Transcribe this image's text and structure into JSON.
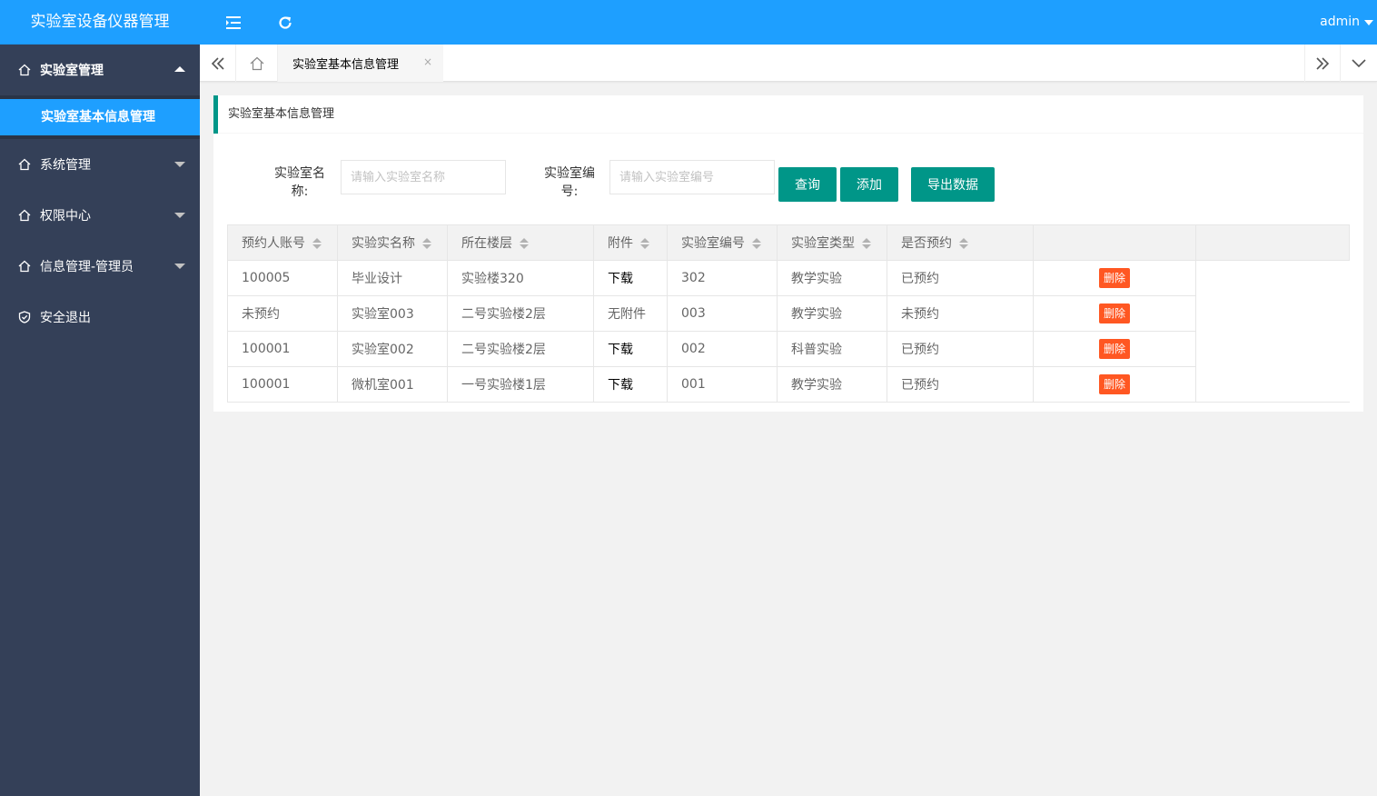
{
  "app": {
    "title": "实验室设备仪器管理"
  },
  "header": {
    "user": "admin"
  },
  "sidebar": {
    "items": [
      {
        "label": "实验室管理",
        "open": true,
        "sub": [
          "实验室基本信息管理"
        ]
      },
      {
        "label": "系统管理"
      },
      {
        "label": "权限中心"
      },
      {
        "label": "信息管理-管理员"
      },
      {
        "label": "安全退出"
      }
    ]
  },
  "tabs": {
    "active": "实验室基本信息管理",
    "close": "×"
  },
  "card": {
    "title": "实验室基本信息管理"
  },
  "search": {
    "name_label_1": "实验室名",
    "name_label_2": "称:",
    "name_placeholder": "请输入实验室名称",
    "code_label_1": "实验室编",
    "code_label_2": "号:",
    "code_placeholder": "请输入实验室编号",
    "query": "查询",
    "add": "添加",
    "export": "导出数据"
  },
  "table": {
    "headers": [
      "预约人账号",
      "实验实名称",
      "所在楼层",
      "附件",
      "实验室编号",
      "实验室类型",
      "是否预约"
    ],
    "rows": [
      [
        "100005",
        "毕业设计",
        "实验楼320",
        "下载",
        "302",
        "教学实验",
        "已预约"
      ],
      [
        "未预约",
        "实验室003",
        "二号实验楼2层",
        "无附件",
        "003",
        "教学实验",
        "未预约"
      ],
      [
        "100001",
        "实验室002",
        "二号实验楼2层",
        "下载",
        "002",
        "科普实验",
        "已预约"
      ],
      [
        "100001",
        "微机室001",
        "一号实验楼1层",
        "下载",
        "001",
        "教学实验",
        "已预约"
      ]
    ],
    "delete": "删除"
  },
  "colors": {
    "primary": "#1e9fff",
    "sidebar": "#344058",
    "button": "#009688",
    "danger": "#ff5722"
  }
}
